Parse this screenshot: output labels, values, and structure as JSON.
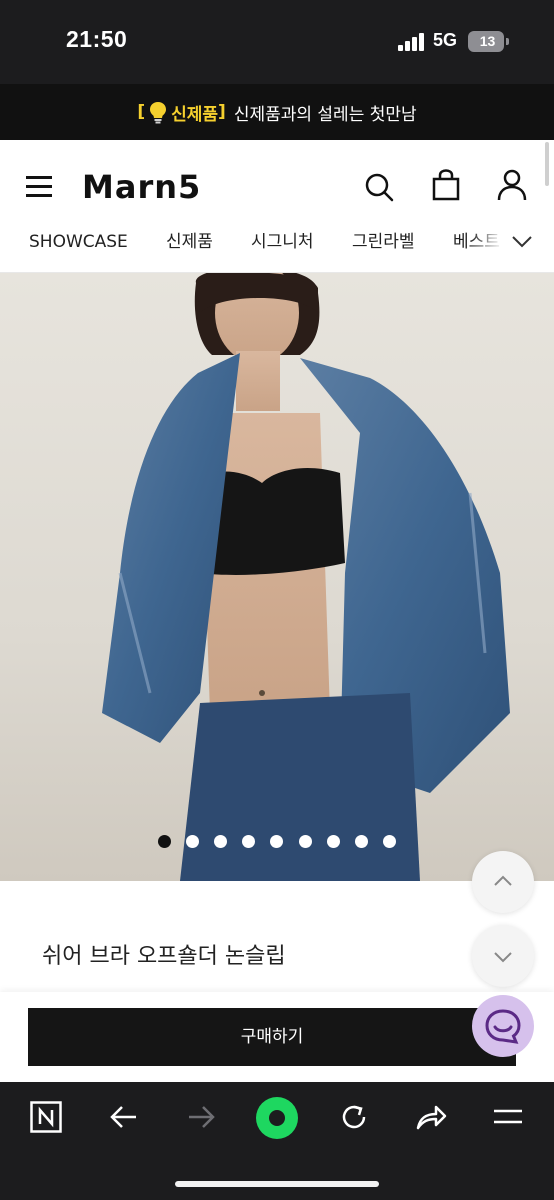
{
  "status_bar": {
    "time": "21:50",
    "network": "5G",
    "battery": "13"
  },
  "promo": {
    "bracket_open": "[",
    "tag": "신제품",
    "bracket_close": "]",
    "message": "신제품과의 설레는 첫만남"
  },
  "header": {
    "logo": "Marn5"
  },
  "nav": {
    "items": [
      "SHOWCASE",
      "신제품",
      "시그니처",
      "그린라벨",
      "베스트"
    ]
  },
  "carousel": {
    "total": 9,
    "active_index": 0
  },
  "product": {
    "title": "쉬어 브라 오프숄더 논슬립"
  },
  "buy_bar": {
    "buy_label": "구매하기"
  },
  "colors": {
    "promo_accent": "#f5d02e",
    "browser_accent": "#1ed760",
    "chat_bubble": "#d6c1ec"
  },
  "icons": {
    "header": [
      "menu-icon",
      "search-icon",
      "shopping-bag-icon",
      "user-icon",
      "chevron-down-icon"
    ],
    "toolbar": [
      "naver-n-icon",
      "back-arrow-icon",
      "forward-arrow-icon",
      "green-dot-icon",
      "refresh-icon",
      "share-icon",
      "menu-lines-icon"
    ]
  }
}
